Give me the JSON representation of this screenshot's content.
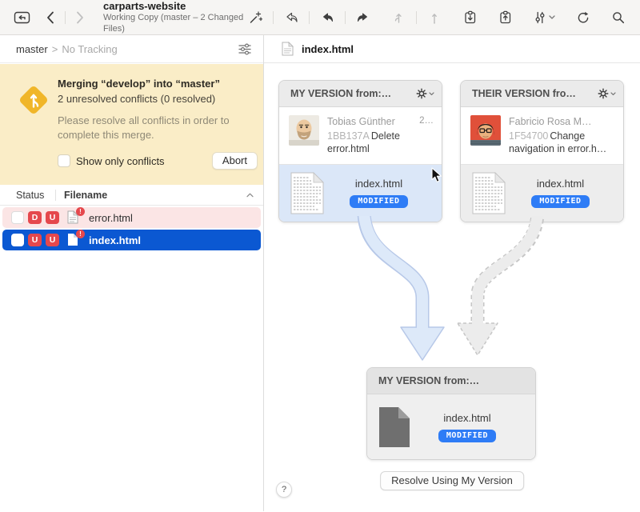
{
  "colors": {
    "selection_blue": "#0b58d2",
    "conflict_red": "#e5484d",
    "modified_badge_blue": "#2e7cf6",
    "banner_yellow": "#faedc7",
    "merge_icon_gold": "#f0b629",
    "my_version_tile_blue": "#dbe7f8"
  },
  "toolbar": {
    "title": "carparts-website",
    "subtitle": "Working Copy (master – 2 Changed Files)",
    "icons": [
      "sidebar-toggle",
      "back",
      "forward",
      "wand",
      "undo",
      "merge-left",
      "merge-right",
      "pull-branch",
      "push-arrow",
      "stash-save",
      "stash-apply",
      "filter-sliders",
      "refresh",
      "search"
    ]
  },
  "sidebar": {
    "branch": "master",
    "separator": ">",
    "tracking": "No Tracking",
    "banner": {
      "title": "Merging “develop” into “master”",
      "subtitle": "2 unresolved conflicts (0 resolved)",
      "description": "Please resolve all conflicts in order to complete this merge.",
      "checkbox_label": "Show only conflicts",
      "abort_label": "Abort"
    },
    "table": {
      "col_status": "Status",
      "col_filename": "Filename",
      "rows": [
        {
          "name": "error.html",
          "badge1": "D",
          "badge2": "U",
          "alert": "!",
          "state": "conflict"
        },
        {
          "name": "index.html",
          "badge1": "U",
          "badge2": "U",
          "alert": "!",
          "state": "selected"
        }
      ]
    }
  },
  "main": {
    "file_title": "index.html",
    "my_card": {
      "title": "MY VERSION from:…",
      "author": "Tobias Günther",
      "meta": "2…",
      "hash": "1BB137A",
      "message": "Delete error.html",
      "file": "index.html",
      "badge": "MODIFIED"
    },
    "their_card": {
      "title": "THEIR VERSION fro…",
      "author": "Fabricio Rosa M…",
      "hash": "1F54700",
      "message": "Change navigation in error.h…",
      "file": "index.html",
      "badge": "MODIFIED"
    },
    "result_card": {
      "title": "MY VERSION from:…",
      "file": "index.html",
      "badge": "MODIFIED"
    },
    "resolve_button": "Resolve Using My Version",
    "help_button": "?"
  }
}
